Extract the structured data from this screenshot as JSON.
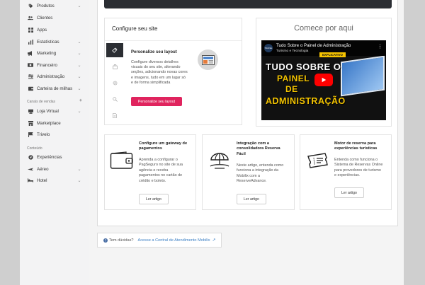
{
  "sidebar": {
    "items": [
      {
        "label": "Produtos",
        "icon": "tag-icon",
        "chevron": true
      },
      {
        "label": "Clientes",
        "icon": "users-icon",
        "chevron": false
      },
      {
        "label": "Apps",
        "icon": "grid-icon",
        "chevron": false
      },
      {
        "label": "Estatísticas",
        "icon": "bar-chart-icon",
        "chevron": true
      },
      {
        "label": "Marketing",
        "icon": "megaphone-icon",
        "chevron": true
      },
      {
        "label": "Financeiro",
        "icon": "money-icon",
        "chevron": true
      },
      {
        "label": "Administração",
        "icon": "sliders-icon",
        "chevron": true
      },
      {
        "label": "Carteira de milhas",
        "icon": "wallet-icon",
        "chevron": true
      }
    ],
    "sales_section": "Canais de vendas",
    "sales_items": [
      {
        "label": "Loja Virtual",
        "icon": "store-icon",
        "chevron": true
      },
      {
        "label": "Marketplace",
        "icon": "shop-icon",
        "chevron": false
      },
      {
        "label": "Trivelo",
        "icon": "flag-icon",
        "chevron": false
      }
    ],
    "content_section": "Conteúdo",
    "content_items": [
      {
        "label": "Experiências",
        "icon": "compass-icon",
        "chevron": false
      },
      {
        "label": "Aéreo",
        "icon": "plane-icon",
        "chevron": true
      },
      {
        "label": "Hotel",
        "icon": "bed-icon",
        "chevron": true
      }
    ]
  },
  "configure": {
    "title": "Configure seu site",
    "panel_title": "Personalize seu layout",
    "panel_desc": [
      "Configure diversos detalhes",
      "visuais do seu site, alterando",
      "seções, adicionando novas cores",
      "e imagens, tudo em um lugar só",
      "e de forma simplificada"
    ],
    "panel_button": "Personalize seu layout"
  },
  "start": {
    "title": "Comece por aqui",
    "video_title": "Tudo Sobre o Painel de Administração",
    "video_sub": "Turismo e Tecnologia",
    "video_badge": "EXPLICATIVO",
    "video_logo": "TRAVEL",
    "video_lines": [
      "TUDO SOBRE O",
      "PAINEL",
      "DE",
      "ADMINISTRAÇÃO"
    ]
  },
  "info_cards": [
    {
      "title": [
        "Configure um gateway de",
        "pagamentos"
      ],
      "desc": [
        "Aprenda a configurar o",
        "PagSeguro no site de sua",
        "agência e receba",
        "pagamentos no cartão de",
        "crédito e boleto."
      ],
      "button": "Ler artigo",
      "icon": "wallet-icon"
    },
    {
      "title": [
        "Integração com a",
        "consolidadora Reserva",
        "Fácil"
      ],
      "desc": [
        "Neste artigo, entenda como",
        "funciona a integração da",
        "Mobilix com a",
        "ReserveAdvance."
      ],
      "button": "Ler artigo",
      "icon": "beach-umbrella-icon"
    },
    {
      "title": [
        "Motor de reserva para",
        "experiências turísticas"
      ],
      "desc": [
        "Entenda como funciona o",
        "Sistema de Reservas Online",
        "para provedores de turismo",
        "e experiências."
      ],
      "button": "Ler artigo",
      "icon": "ticket-icon"
    }
  ],
  "help": {
    "question": "Tem dúvidas?",
    "link": "Acesse a Central de Atendimento Mobilix"
  },
  "colors": {
    "accent": "#e0245e",
    "dark": "#2b2e33",
    "link": "#3b7fc4"
  }
}
